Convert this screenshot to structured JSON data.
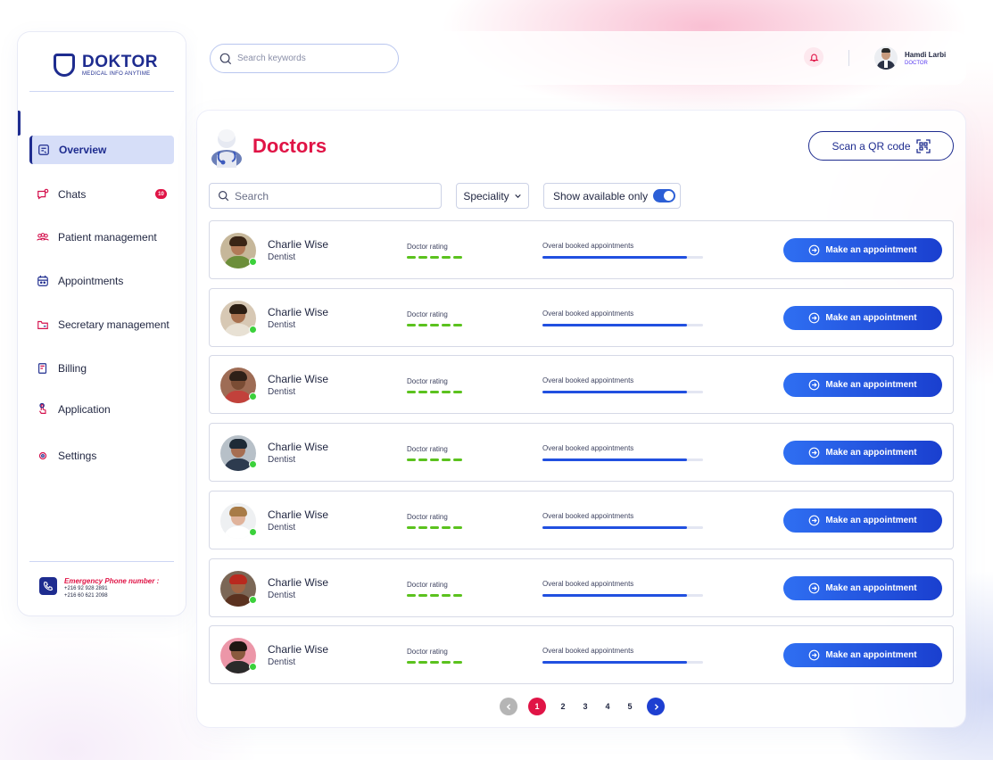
{
  "brand": {
    "name": "DOKTOR",
    "tagline": "MEDICAL INFO ANYTIME"
  },
  "sidebar": {
    "items": [
      {
        "label": "Overview",
        "icon": "overview-icon",
        "active": true
      },
      {
        "label": "Chats",
        "icon": "chat-icon",
        "badge": "10"
      },
      {
        "label": "Patient management",
        "icon": "patients-icon"
      },
      {
        "label": "Appointments",
        "icon": "calendar-icon"
      },
      {
        "label": "Secretary management",
        "icon": "folder-icon"
      },
      {
        "label": "Billing",
        "icon": "billing-icon"
      },
      {
        "label": "Application",
        "icon": "tap-icon"
      },
      {
        "label": "Settings",
        "icon": "settings-icon"
      }
    ],
    "emergency": {
      "title": "Emergency Phone number :",
      "phones": [
        "+216 92 928 2891",
        "+216 60 621 2098"
      ]
    }
  },
  "topbar": {
    "search_placeholder": "Search keywords",
    "user": {
      "name": "Hamdi Larbi",
      "role": "DOCTOR"
    }
  },
  "main": {
    "title": "Doctors",
    "qr_button": "Scan a QR code",
    "search_placeholder": "Search",
    "filter": {
      "label": "Speciality"
    },
    "available_toggle": {
      "label": "Show available only",
      "on": true
    }
  },
  "doctors": [
    {
      "name": "Charlie Wise",
      "specialty": "Dentist",
      "rating_label": "Doctor rating",
      "rating": 5,
      "booked_label": "Overal booked appointments",
      "booked": 0.9,
      "button": "Make an appointment"
    },
    {
      "name": "Charlie Wise",
      "specialty": "Dentist",
      "rating_label": "Doctor rating",
      "rating": 5,
      "booked_label": "Overal booked appointments",
      "booked": 0.9,
      "button": "Make an appointment"
    },
    {
      "name": "Charlie Wise",
      "specialty": "Dentist",
      "rating_label": "Doctor rating",
      "rating": 5,
      "booked_label": "Overal booked appointments",
      "booked": 0.9,
      "button": "Make an appointment"
    },
    {
      "name": "Charlie Wise",
      "specialty": "Dentist",
      "rating_label": "Doctor rating",
      "rating": 5,
      "booked_label": "Overal booked appointments",
      "booked": 0.9,
      "button": "Make an appointment"
    },
    {
      "name": "Charlie Wise",
      "specialty": "Dentist",
      "rating_label": "Doctor rating",
      "rating": 5,
      "booked_label": "Overal booked appointments",
      "booked": 0.9,
      "button": "Make an appointment"
    },
    {
      "name": "Charlie Wise",
      "specialty": "Dentist",
      "rating_label": "Doctor rating",
      "rating": 5,
      "booked_label": "Overal booked appointments",
      "booked": 0.9,
      "button": "Make an appointment"
    },
    {
      "name": "Charlie Wise",
      "specialty": "Dentist",
      "rating_label": "Doctor rating",
      "rating": 5,
      "booked_label": "Overal booked appointments",
      "booked": 0.9,
      "button": "Make an appointment"
    }
  ],
  "pagination": {
    "pages": [
      "1",
      "2",
      "3",
      "4",
      "5"
    ],
    "current": "1"
  },
  "colors": {
    "brand": "#1e2c8f",
    "accent": "#e01446",
    "primary_button": "#2150e0",
    "rating": "#5bc21e",
    "online": "#3bd13b"
  }
}
